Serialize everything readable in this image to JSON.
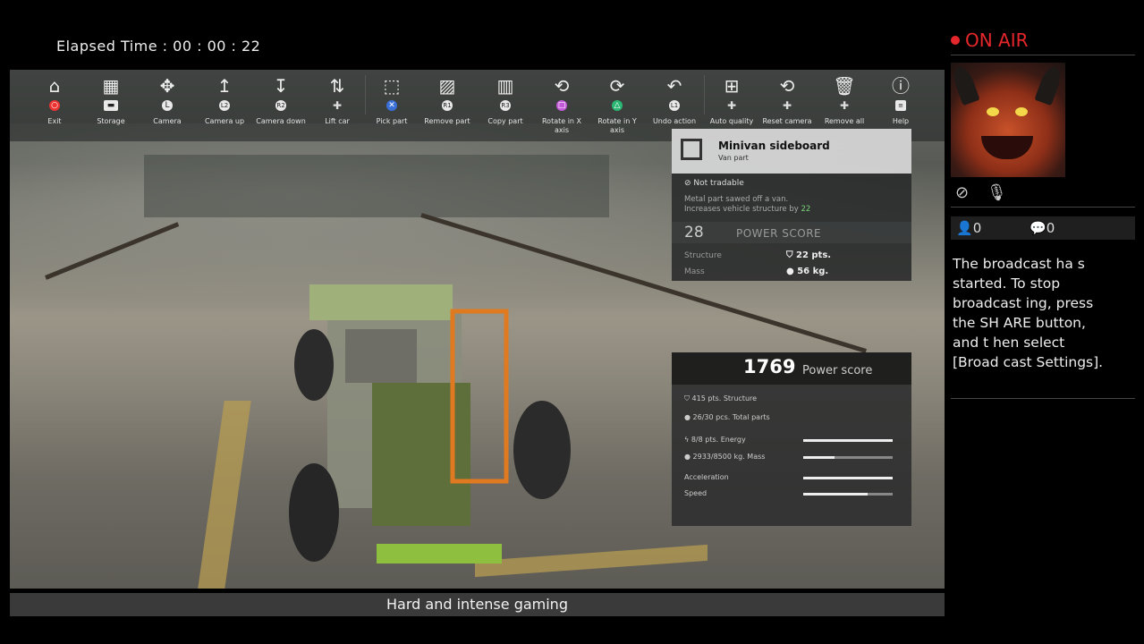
{
  "stream": {
    "elapsed_label": "Elapsed Time",
    "elapsed_value": "00 : 00 : 22",
    "on_air": "ON AIR",
    "title": "Hard and intense gaming",
    "viewers": "0",
    "comments": "0",
    "message": "The broadcast ha s started. To stop broadcast ing, press the SH ARE button, and t hen select [Broad cast Settings]."
  },
  "toolbar": {
    "items": [
      {
        "label": "Exit",
        "icon": "garage-icon",
        "button": "circle"
      },
      {
        "label": "Storage",
        "icon": "storage-icon",
        "button": "touchpad"
      },
      {
        "label": "Camera",
        "icon": "move-arrows-icon",
        "button": "left-stick"
      },
      {
        "label": "Camera up",
        "icon": "arrow-up-icon",
        "button": "L2"
      },
      {
        "label": "Camera down",
        "icon": "arrow-down-icon",
        "button": "R2"
      },
      {
        "label": "Lift car",
        "icon": "lift-icon",
        "button": "dpad"
      },
      {
        "label": "Pick part",
        "icon": "pick-icon",
        "button": "cross"
      },
      {
        "label": "Remove part",
        "icon": "remove-part-icon",
        "button": "R1"
      },
      {
        "label": "Copy part",
        "icon": "copy-part-icon",
        "button": "R3"
      },
      {
        "label": "Rotate in X axis",
        "icon": "rotate-x-icon",
        "button": "square"
      },
      {
        "label": "Rotate in Y axis",
        "icon": "rotate-y-icon",
        "button": "triangle"
      },
      {
        "label": "Undo action",
        "icon": "undo-icon",
        "button": "L1"
      },
      {
        "label": "Auto quality",
        "icon": "grid-icon",
        "button": "dpad"
      },
      {
        "label": "Reset camera",
        "icon": "reset-camera-icon",
        "button": "dpad"
      },
      {
        "label": "Remove all",
        "icon": "trash-icon",
        "button": "dpad"
      },
      {
        "label": "Help",
        "icon": "help-icon",
        "button": "options"
      }
    ]
  },
  "part": {
    "name": "Minivan sideboard",
    "type": "Van part",
    "tradable": "Not tradable",
    "description_1": "Metal part sawed off a van.",
    "description_2": "Increases vehicle structure by",
    "description_value": "22",
    "power_score_value": "28",
    "power_score_label": "POWER SCORE",
    "structure_label": "Structure",
    "structure_value": "22 pts.",
    "mass_label": "Mass",
    "mass_value": "56 kg."
  },
  "summary": {
    "power_score": "1769",
    "power_score_label": "Power score",
    "structure": "415 pts. Structure",
    "parts": "26/30 pcs. Total parts",
    "energy": "8/8 pts. Energy",
    "energy_fill": 1.0,
    "mass": "2933/8500 kg. Mass",
    "mass_fill": 0.35,
    "acceleration_label": "Acceleration",
    "acceleration_fill": 1.0,
    "speed_label": "Speed",
    "speed_fill": 0.72
  }
}
